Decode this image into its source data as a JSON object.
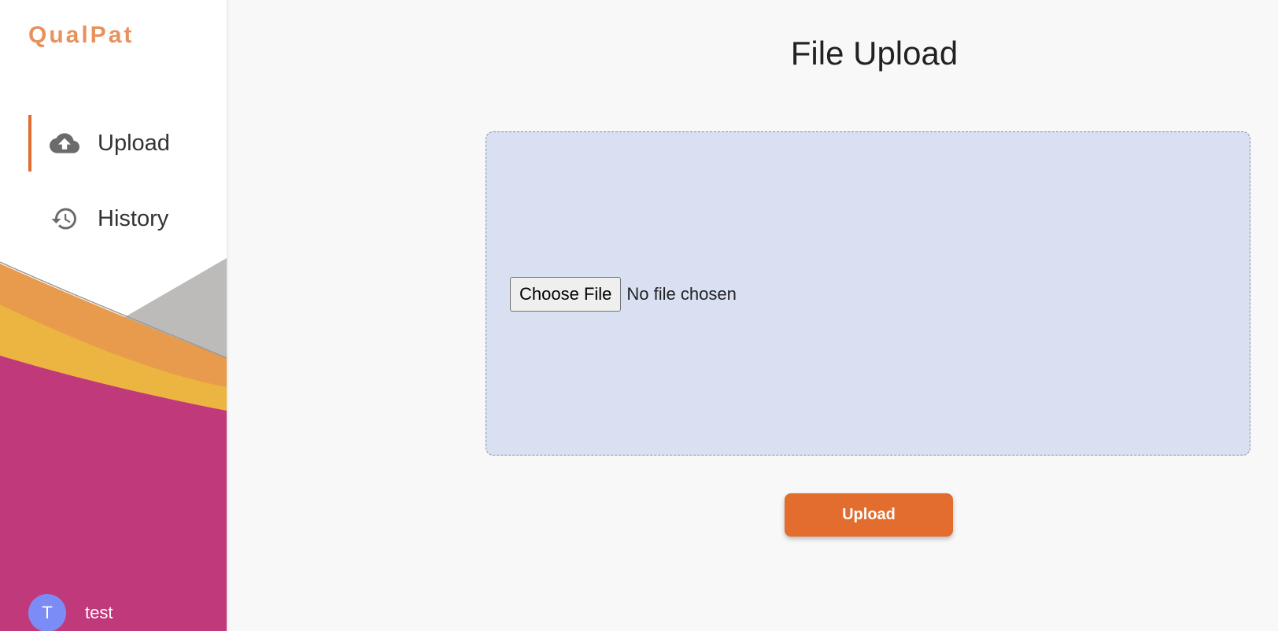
{
  "app": {
    "brand": "QualPat"
  },
  "sidebar": {
    "items": [
      {
        "label": "Upload",
        "icon": "cloud-upload-icon",
        "active": true
      },
      {
        "label": "History",
        "icon": "history-icon",
        "active": false
      }
    ],
    "user": {
      "initial": "T",
      "name": "test"
    }
  },
  "main": {
    "title": "File Upload",
    "file_input": {
      "button_label": "Choose File",
      "status": "No file chosen"
    },
    "upload_label": "Upload"
  },
  "colors": {
    "accent": "#e36d2f",
    "brand": "#e9915c",
    "dropzone_bg": "#d8e0f2",
    "avatar": "#7c8cf7",
    "wave_magenta": "#c03a7b",
    "wave_yellow": "#ecb440",
    "wave_orange": "#e89a4d",
    "wave_gray": "#bcbbba"
  }
}
